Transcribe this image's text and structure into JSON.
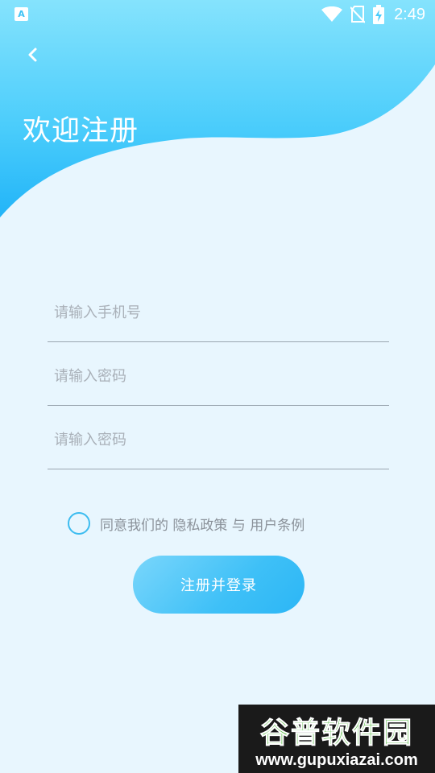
{
  "status_bar": {
    "left_icon_letter": "A",
    "time": "2:49",
    "icons": [
      "wifi-icon",
      "no-sim-icon",
      "battery-charging-icon"
    ]
  },
  "header": {
    "back_icon": "chevron-left-icon",
    "title": "欢迎注册",
    "gradient_colors": [
      "#7fe0fd",
      "#2ab8f8"
    ]
  },
  "form": {
    "phone_placeholder": "请输入手机号",
    "password_placeholder": "请输入密码",
    "confirm_password_placeholder": "请输入密码"
  },
  "agreement": {
    "prefix": "同意我们的 ",
    "privacy_link": "隐私政策",
    "joiner": " 与 ",
    "terms_link": "用户条例"
  },
  "submit_label": "注册并登录",
  "watermark": {
    "title": "谷普软件园",
    "url": "www.gupuxiazai.com"
  },
  "colors": {
    "accent": "#3ec0f7",
    "background": "#e8f6fe"
  }
}
